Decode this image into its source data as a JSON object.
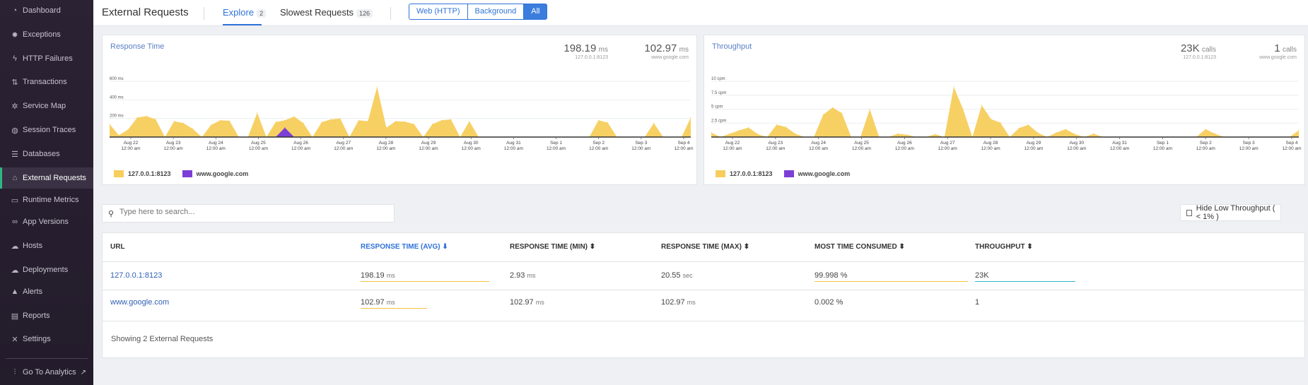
{
  "sidebar": {
    "items": [
      {
        "label": "Dashboard",
        "icon": "gauge-icon",
        "glyph": "◔"
      },
      {
        "label": "Exceptions",
        "icon": "bug-icon",
        "glyph": "✹"
      },
      {
        "label": "HTTP Failures",
        "icon": "bolt-icon",
        "glyph": "ϟ"
      },
      {
        "label": "Transactions",
        "icon": "transactions-icon",
        "glyph": "⇅"
      },
      {
        "label": "Service Map",
        "icon": "gear-icon",
        "glyph": "✲"
      },
      {
        "label": "Session Traces",
        "icon": "globe-icon",
        "glyph": "◍"
      },
      {
        "label": "Databases",
        "icon": "database-icon",
        "glyph": "☰"
      },
      {
        "label": "External Requests",
        "icon": "network-icon",
        "glyph": "⌂"
      },
      {
        "label": "Runtime Metrics",
        "icon": "chart-icon",
        "glyph": "▭"
      },
      {
        "label": "App Versions",
        "icon": "infinity-icon",
        "glyph": "∞"
      },
      {
        "label": "Hosts",
        "icon": "cloud-icon",
        "glyph": "☁"
      },
      {
        "label": "Deployments",
        "icon": "cloud-upload-icon",
        "glyph": "☁"
      },
      {
        "label": "Alerts",
        "icon": "warning-icon",
        "glyph": "▲"
      },
      {
        "label": "Reports",
        "icon": "report-icon",
        "glyph": "▤"
      },
      {
        "label": "Settings",
        "icon": "wrench-icon",
        "glyph": "✕"
      }
    ],
    "active_index": 7,
    "analytics": {
      "label": "Go To Analytics",
      "icon": "analytics-icon",
      "glyph": "⫶",
      "ext_glyph": "↗"
    }
  },
  "topbar": {
    "title": "External Requests",
    "tabs": [
      {
        "label": "Explore",
        "count": "2"
      },
      {
        "label": "Slowest Requests",
        "count": "126"
      }
    ],
    "filters": [
      "Web (HTTP)",
      "Background",
      "All"
    ],
    "active_filter": "All"
  },
  "colors": {
    "series1": "#f7cd5c",
    "series2": "#7b3fd6",
    "accent": "#2f73d9",
    "throughput_bar": "#2bb9c7"
  },
  "charts": {
    "response_time": {
      "title": "Response Time",
      "stats": [
        {
          "value": "198.19",
          "unit": "ms",
          "host": "127.0.0.1:8123"
        },
        {
          "value": "102.97",
          "unit": "ms",
          "host": "www.google.com"
        }
      ],
      "legend": [
        "127.0.0.1:8123",
        "www.google.com"
      ]
    },
    "throughput": {
      "title": "Throughput",
      "stats": [
        {
          "value": "23K",
          "unit": "calls",
          "host": "127.0.0.1:8123"
        },
        {
          "value": "1",
          "unit": "calls",
          "host": "www.google.com"
        }
      ],
      "legend": [
        "127.0.0.1:8123",
        "www.google.com"
      ]
    }
  },
  "chart_data": [
    {
      "type": "area",
      "title": "Response Time",
      "yticks": [
        "600 ms",
        "400 ms",
        "200 ms"
      ],
      "ylim": [
        0,
        600
      ],
      "xticks": [
        [
          "Aug 22",
          "12:00 am"
        ],
        [
          "Aug 23",
          "12:00 am"
        ],
        [
          "Aug 24",
          "12:00 am"
        ],
        [
          "Aug 25",
          "12:00 am"
        ],
        [
          "Aug 26",
          "12:00 am"
        ],
        [
          "Aug 27",
          "12:00 am"
        ],
        [
          "Aug 28",
          "12:00 am"
        ],
        [
          "Aug 29",
          "12:00 am"
        ],
        [
          "Aug 30",
          "12:00 am"
        ],
        [
          "Aug 31",
          "12:00 am"
        ],
        [
          "Sep 1",
          "12:00 am"
        ],
        [
          "Sep 2",
          "12:00 am"
        ],
        [
          "Sep 3",
          "12:00 am"
        ],
        [
          "Sep 4",
          "12:00 am"
        ]
      ],
      "series": [
        {
          "name": "127.0.0.1:8123",
          "values": [
            140,
            20,
            80,
            210,
            225,
            190,
            0,
            170,
            150,
            90,
            0,
            130,
            180,
            175,
            0,
            0,
            260,
            0,
            160,
            180,
            220,
            150,
            0,
            160,
            190,
            200,
            0,
            180,
            170,
            540,
            100,
            170,
            165,
            140,
            0,
            140,
            180,
            190,
            0,
            170,
            0,
            0,
            0,
            0,
            0,
            0,
            0,
            0,
            0,
            0,
            0,
            0,
            0,
            180,
            155,
            0,
            0,
            0,
            0,
            150,
            0,
            0,
            0,
            210
          ]
        },
        {
          "name": "www.google.com",
          "values": [
            0,
            0,
            0,
            0,
            0,
            0,
            0,
            0,
            0,
            0,
            0,
            0,
            0,
            0,
            0,
            0,
            0,
            0,
            0,
            100,
            0,
            0,
            0,
            0,
            0,
            0,
            0,
            0,
            0,
            0,
            0,
            0,
            0,
            0,
            0,
            0,
            0,
            0,
            0,
            0,
            0,
            0,
            0,
            0,
            0,
            0,
            0,
            0,
            0,
            0,
            0,
            0,
            0,
            0,
            0,
            0,
            0,
            0,
            0,
            0,
            0,
            0,
            0,
            0
          ]
        }
      ]
    },
    {
      "type": "area",
      "title": "Throughput",
      "yticks": [
        "10 cpm",
        "7.5 cpm",
        "5 cpm",
        "2.5 cpm"
      ],
      "ylim": [
        0,
        10
      ],
      "xticks": [
        [
          "Aug 22",
          "12:00 am"
        ],
        [
          "Aug 23",
          "12:00 am"
        ],
        [
          "Aug 24",
          "12:00 am"
        ],
        [
          "Aug 25",
          "12:00 am"
        ],
        [
          "Aug 26",
          "12:00 am"
        ],
        [
          "Aug 27",
          "12:00 am"
        ],
        [
          "Aug 28",
          "12:00 am"
        ],
        [
          "Aug 29",
          "12:00 am"
        ],
        [
          "Aug 30",
          "12:00 am"
        ],
        [
          "Aug 31",
          "12:00 am"
        ],
        [
          "Sep 1",
          "12:00 am"
        ],
        [
          "Sep 2",
          "12:00 am"
        ],
        [
          "Sep 3",
          "12:00 am"
        ],
        [
          "Sep 4",
          "12:00 am"
        ]
      ],
      "series": [
        {
          "name": "127.0.0.1:8123",
          "values": [
            0.8,
            0,
            0.6,
            1.2,
            1.7,
            0.5,
            0,
            2.2,
            1.8,
            0.6,
            0,
            0,
            4,
            5.3,
            4.3,
            0,
            0,
            5,
            0,
            0,
            0.6,
            0.4,
            0,
            0,
            0.5,
            0,
            9,
            5,
            0,
            5.7,
            3.2,
            2.6,
            0,
            1.6,
            2.2,
            0.8,
            0,
            0.8,
            1.4,
            0.5,
            0,
            0.6,
            0,
            0,
            0,
            0,
            0,
            0,
            0,
            0,
            0,
            0,
            0,
            1.4,
            0.6,
            0,
            0,
            0,
            0,
            0,
            0,
            0,
            0,
            1.2
          ]
        },
        {
          "name": "www.google.com",
          "values": []
        }
      ]
    }
  ],
  "search": {
    "placeholder": "Type here to search..."
  },
  "hide_low": {
    "label": "Hide Low Throughput ( < 1% )"
  },
  "table": {
    "headers": [
      "URL",
      "RESPONSE TIME (AVG)",
      "RESPONSE TIME (MIN)",
      "RESPONSE TIME (MAX)",
      "MOST TIME CONSUMED",
      "THROUGHPUT"
    ],
    "sort_glyphs": [
      "",
      "⬇",
      "⬍",
      "⬍",
      "⬍",
      "⬍"
    ],
    "rows": [
      {
        "url": "127.0.0.1:8123",
        "avg": "198.19",
        "avg_unit": "ms",
        "min": "2.93",
        "min_unit": "ms",
        "max": "20.55",
        "max_unit": "sec",
        "consumed": "99.998 %",
        "throughput": "23K",
        "avg_fraction": 1.0,
        "consumed_fraction": 1.0,
        "throughput_fraction": 1.0
      },
      {
        "url": "www.google.com",
        "avg": "102.97",
        "avg_unit": "ms",
        "min": "102.97",
        "min_unit": "ms",
        "max": "102.97",
        "max_unit": "ms",
        "consumed": "0.002 %",
        "throughput": "1",
        "avg_fraction": 0.52,
        "consumed_fraction": 0.0,
        "throughput_fraction": 0.0
      }
    ],
    "footer": "Showing 2 External Requests"
  }
}
